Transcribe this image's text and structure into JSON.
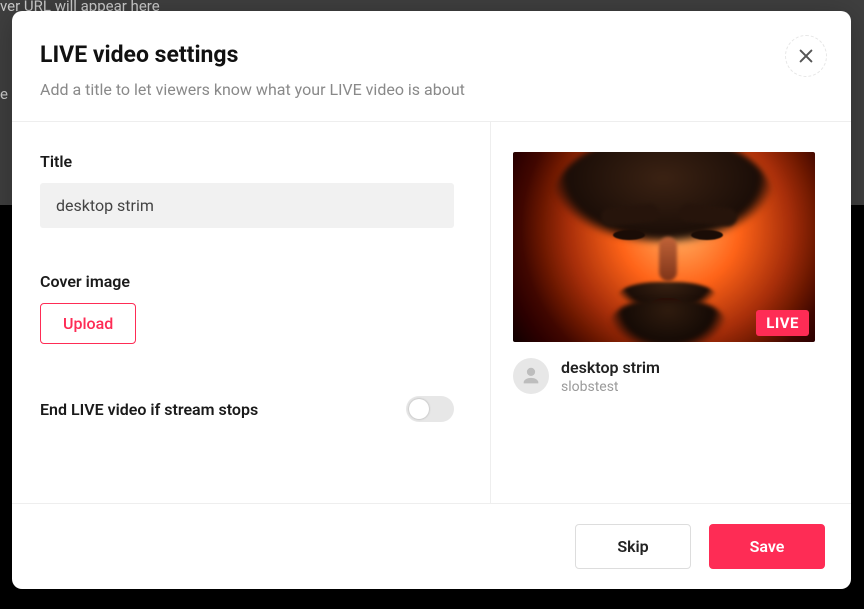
{
  "modal": {
    "title": "LIVE video settings",
    "subtitle": "Add a title to let viewers know what your LIVE video is about"
  },
  "form": {
    "title_label": "Title",
    "title_value": "desktop strim",
    "cover_label": "Cover image",
    "upload_label": "Upload",
    "end_stream_label": "End LIVE video if stream stops",
    "end_stream_on": false
  },
  "preview": {
    "badge": "LIVE",
    "title": "desktop strim",
    "username": "slobstest"
  },
  "buttons": {
    "skip": "Skip",
    "save": "Save"
  },
  "colors": {
    "accent": "#fe2c55"
  }
}
